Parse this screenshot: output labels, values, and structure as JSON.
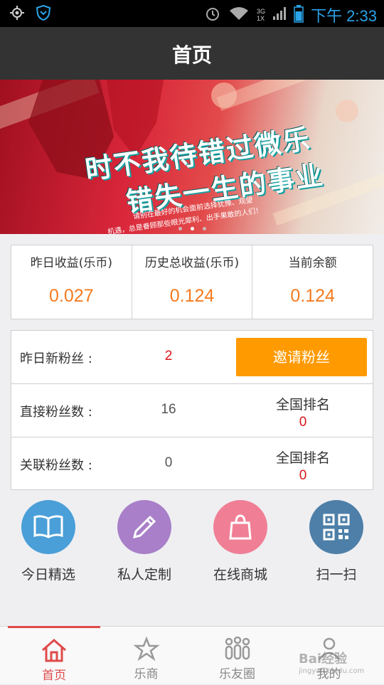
{
  "status_bar": {
    "time": "下午 2:33",
    "network_top": "3G",
    "network_bottom": "1X",
    "icons": [
      "gps-icon",
      "shield-icon",
      "alarm-icon",
      "wifi-icon",
      "signal-icon",
      "battery-icon"
    ]
  },
  "header": {
    "title": "首页"
  },
  "banner": {
    "slogan_line1": "时不我待错过微乐",
    "slogan_line2": "错失一生的事业",
    "sub_line1": "请别在最好的机会面前选择犹豫、观望",
    "sub_line2": "机遇，总是眷顾那些眼光犀利、出手果敢的人们！",
    "slide_count": 3,
    "active_slide": 2
  },
  "earnings": [
    {
      "label": "昨日收益(乐币)",
      "value": "0.027"
    },
    {
      "label": "历史总收益(乐币)",
      "value": "0.124"
    },
    {
      "label": "当前余额",
      "value": "0.124"
    }
  ],
  "fans": {
    "new_label": "昨日新粉丝 :",
    "new_value": "2",
    "invite_label": "邀请粉丝",
    "direct_label": "直接粉丝数 :",
    "direct_value": "16",
    "direct_rank_label": "全国排名",
    "direct_rank_value": "0",
    "related_label": "关联粉丝数 :",
    "related_value": "0",
    "related_rank_label": "全国排名",
    "related_rank_value": "0"
  },
  "shortcuts": [
    {
      "label": "今日精选",
      "icon": "book-icon",
      "color": "#4a9fd8"
    },
    {
      "label": "私人定制",
      "icon": "pencil-icon",
      "color": "#a87fc8"
    },
    {
      "label": "在线商城",
      "icon": "shopping-bag-icon",
      "color": "#f07f95"
    },
    {
      "label": "扫一扫",
      "icon": "qr-code-icon",
      "color": "#4d7fa8"
    }
  ],
  "tabs": [
    {
      "label": "首页",
      "icon": "home-icon",
      "active": true
    },
    {
      "label": "乐商",
      "icon": "star-icon",
      "active": false
    },
    {
      "label": "乐友圈",
      "icon": "people-icon",
      "active": false
    },
    {
      "label": "我的",
      "icon": "user-icon",
      "active": false
    }
  ],
  "watermark": {
    "brand": "Bai经验",
    "url": "jingyan.baidu.com"
  },
  "colors": {
    "accent": "#e04a4a",
    "orange": "#f47b20",
    "button": "#ff9a00",
    "red_value": "#d9141c"
  }
}
